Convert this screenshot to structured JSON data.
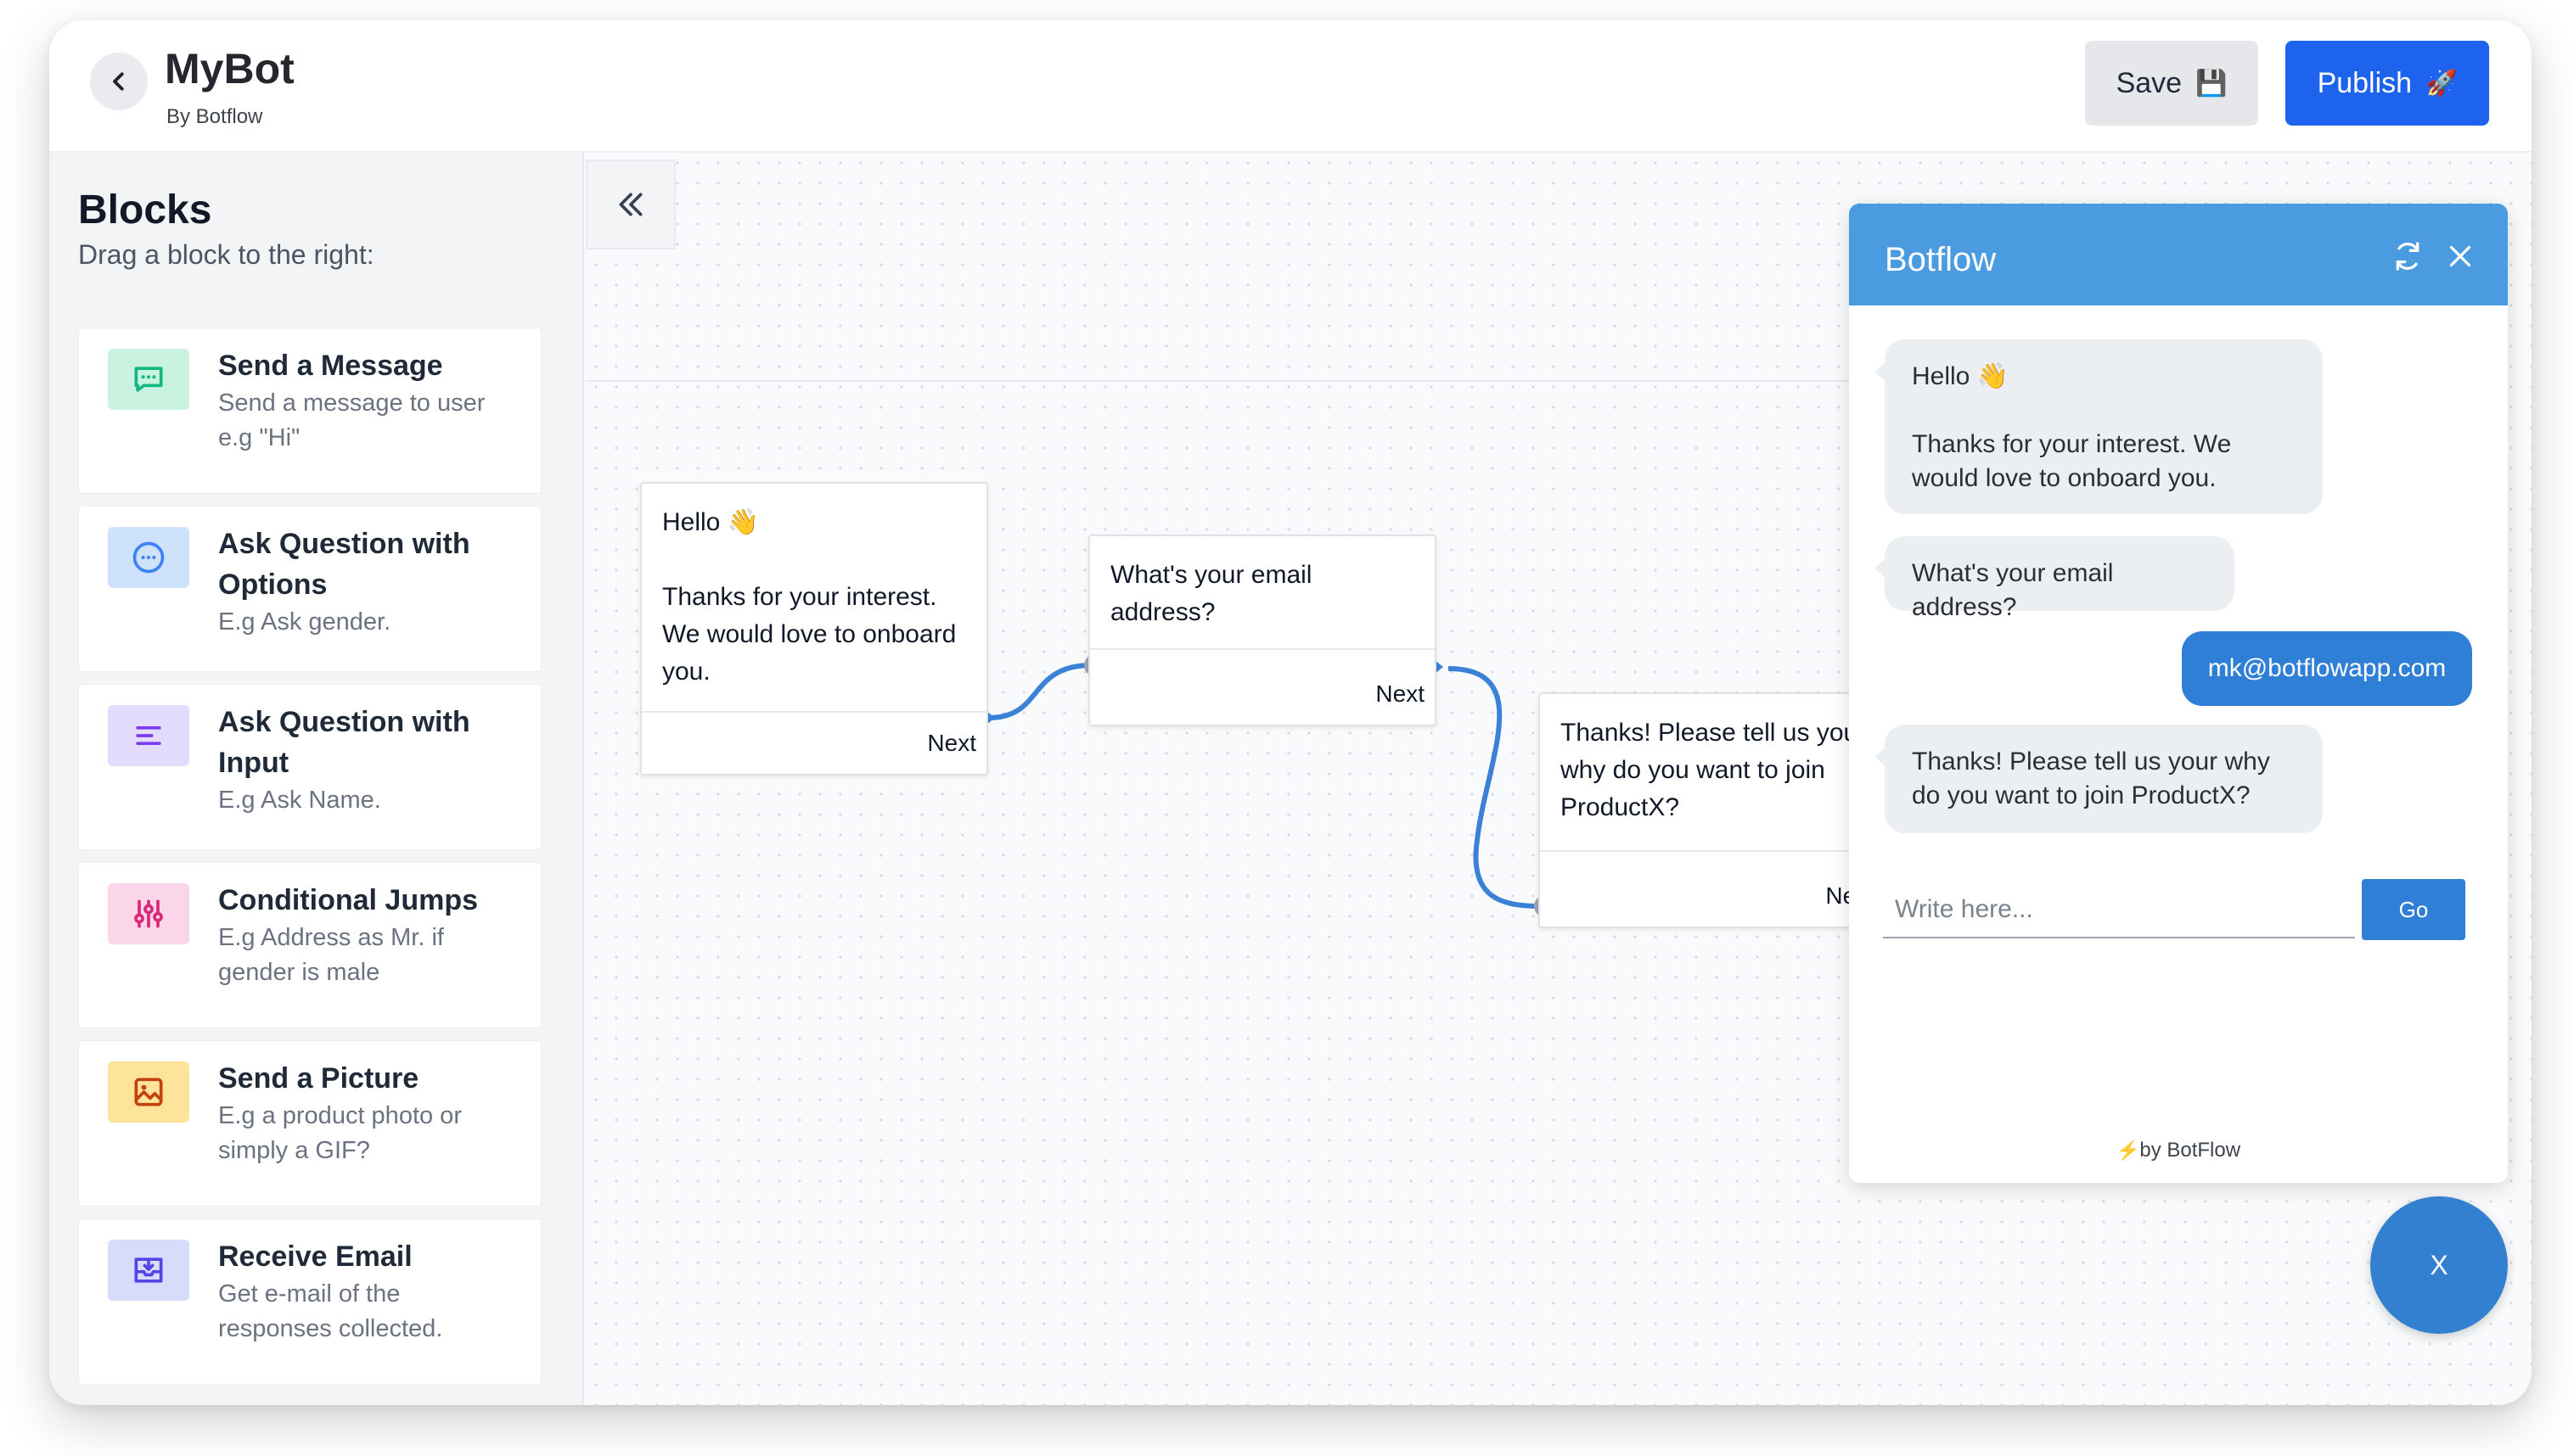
{
  "header": {
    "title": "MyBot",
    "subtitle": "By Botflow",
    "save_label": "Save",
    "save_icon": "💾",
    "publish_label": "Publish",
    "publish_icon": "🚀"
  },
  "sidebar": {
    "title": "Blocks",
    "subtitle": "Drag a block to the right:",
    "blocks": [
      {
        "name": "Send a Message",
        "desc": "Send a message to user e.g \"Hi\"",
        "icon": "chat-bubble-icon",
        "color": "#34d399",
        "bg": "#d1fae5"
      },
      {
        "name": "Ask Question with Options",
        "desc": "E.g Ask gender.",
        "icon": "options-icon",
        "color": "#3b82f6",
        "bg": "#dbeafe"
      },
      {
        "name": "Ask Question with Input",
        "desc": "E.g Ask Name.",
        "icon": "text-lines-icon",
        "color": "#8b5cf6",
        "bg": "#ede9fe"
      },
      {
        "name": "Conditional Jumps",
        "desc": "E.g Address as Mr. if gender is male",
        "icon": "sliders-icon",
        "color": "#db2777",
        "bg": "#fce7f3"
      },
      {
        "name": "Send a Picture",
        "desc": "E.g a product photo or simply a GIF?",
        "icon": "picture-icon",
        "color": "#d97706",
        "bg": "#fde68a"
      },
      {
        "name": "Receive Email",
        "desc": "Get e-mail of the responses collected.",
        "icon": "inbox-icon",
        "color": "#4f46e5",
        "bg": "#e0e7ff"
      }
    ]
  },
  "canvas": {
    "nodes": [
      {
        "line1": "Hello 👋",
        "line2": "Thanks for your interest. We would love to onboard you.",
        "next": "Next"
      },
      {
        "text": "What's your email address?",
        "next": "Next"
      },
      {
        "text": "Thanks! Please tell us your why do you want to join ProductX?",
        "next": "Next"
      }
    ]
  },
  "chat": {
    "title": "Botflow",
    "messages": [
      {
        "from": "bot",
        "line1": "Hello 👋",
        "line2": "Thanks for your interest. We would love to onboard you."
      },
      {
        "from": "bot",
        "text": "What's your email address?"
      },
      {
        "from": "user",
        "text": "mk@botflowapp.com"
      },
      {
        "from": "bot",
        "text": "Thanks! Please tell us your why do you want to join ProductX?"
      }
    ],
    "input_placeholder": "Write here...",
    "input_value": "",
    "go_label": "Go",
    "footer_bolt": "⚡",
    "footer_text": "by BotFlow",
    "toggle_label": "X",
    "header_color": "#4b9be0",
    "accent_color": "#2f7fd6"
  }
}
